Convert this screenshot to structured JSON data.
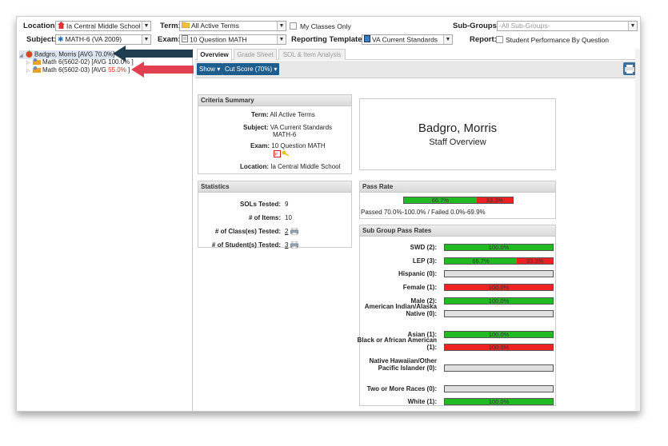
{
  "filters": {
    "location_label": "Location:",
    "location_value": "Ia Central Middle School",
    "term_label": "Term:",
    "term_value": "All Active Terms",
    "my_classes_label": "My Classes Only",
    "subgroups_label": "Sub-Groups:",
    "subgroups_value": "-All Sub-Groups-",
    "subject_label": "Subject:",
    "subject_value": "MATH-6 (VA 2009)",
    "exam_label": "Exam:",
    "exam_value": "10 Question MATH",
    "template_label": "Reporting Template:",
    "template_value": "VA Current Standards",
    "report_label": "Report:",
    "report_value": "Student Performance By Question"
  },
  "tree": {
    "root": "Badgro, Morris [AVG 70.0%]",
    "children": [
      {
        "prefix": "Math 6(5602-02) [AVG ",
        "avg": "100.0%",
        "suffix": " ]",
        "avg_color": "#222222"
      },
      {
        "prefix": "Math 6(5602-03) [AVG ",
        "avg": "55.0%",
        "suffix": " ]",
        "avg_color": "#e02020"
      }
    ]
  },
  "tabs": [
    "Overview",
    "Grade Sheet",
    "SOL & Item Analysis"
  ],
  "buttons": {
    "show": "Show ▾",
    "cut_score": "Cut Score (70%) ▾"
  },
  "criteria": {
    "title": "Criteria Summary",
    "term_label": "Term:",
    "term_value": "All Active Terms",
    "subject_label": "Subject:",
    "subject_value_1": "VA Current Standards",
    "subject_value_2": "MATH-6",
    "exam_label": "Exam:",
    "exam_value": "10 Question MATH",
    "location_label": "Location:",
    "location_value": "Ia Central Middle School"
  },
  "staff": {
    "name": "Badgro, Morris",
    "subtitle": "Staff Overview"
  },
  "statistics": {
    "title": "Statistics",
    "rows": [
      {
        "label": "SOLs Tested:",
        "value": "9",
        "link": false
      },
      {
        "label": "# of Items:",
        "value": "10",
        "link": false
      },
      {
        "label": "# of Class(es) Tested:",
        "value": "2",
        "link": true
      },
      {
        "label": "# of Student(s) Tested:",
        "value": "3",
        "link": true
      }
    ]
  },
  "pass_rate": {
    "title": "Pass Rate",
    "pass": "66.7%",
    "fail": "33.3%",
    "pass_fraction": 0.667,
    "caption": "Passed 70.0%-100.0% / Failed 0.0%-69.9%"
  },
  "subgroups": {
    "title": "Sub Group Pass Rates",
    "rows": [
      {
        "label": "SWD (2):",
        "pass": "100.0%",
        "fail": "",
        "pass_fraction": 1.0,
        "fail_fraction": 0
      },
      {
        "label": "LEP (3):",
        "pass": "66.7%",
        "fail": "33.3%",
        "pass_fraction": 0.667,
        "fail_fraction": 0.333
      },
      {
        "label": "Hispanic (0):",
        "pass": "",
        "fail": "",
        "pass_fraction": 0,
        "fail_fraction": 0
      },
      {
        "label": "Female (1):",
        "pass": "",
        "fail": "100.0%",
        "pass_fraction": 0,
        "fail_fraction": 1.0
      },
      {
        "label": "Male (2):",
        "pass": "100.0%",
        "fail": "",
        "pass_fraction": 1.0,
        "fail_fraction": 0
      },
      {
        "label": "American Indian/Alaska Native (0):",
        "pass": "",
        "fail": "",
        "pass_fraction": 0,
        "fail_fraction": 0
      },
      {
        "label": "Asian (1):",
        "pass": "100.0%",
        "fail": "",
        "pass_fraction": 1.0,
        "fail_fraction": 0
      },
      {
        "label": "Black or African American (1):",
        "pass": "",
        "fail": "100.0%",
        "pass_fraction": 0,
        "fail_fraction": 1.0
      },
      {
        "label": "Native Hawaiian/Other Pacific Islander (0):",
        "pass": "",
        "fail": "",
        "pass_fraction": 0,
        "fail_fraction": 0
      },
      {
        "label": "Two or More Races (0):",
        "pass": "",
        "fail": "",
        "pass_fraction": 0,
        "fail_fraction": 0
      },
      {
        "label": "White (1):",
        "pass": "100.0%",
        "fail": "",
        "pass_fraction": 1.0,
        "fail_fraction": 0
      }
    ]
  },
  "colors": {
    "pass": "#22bb22",
    "fail": "#ee2222",
    "button": "#1e5e8e",
    "arrow_dark": "#1f3d4f",
    "arrow_red": "#e04050"
  },
  "icons": {
    "location": "school-icon",
    "subject": "star-icon",
    "term": "folder-icon",
    "exam": "document-icon",
    "template": "template-icon",
    "print": "print-icon"
  }
}
